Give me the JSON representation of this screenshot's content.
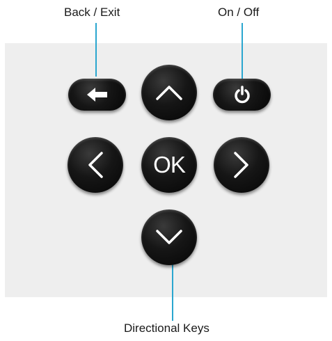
{
  "labels": {
    "back_exit": "Back / Exit",
    "on_off": "On / Off",
    "directional_keys": "Directional Keys"
  },
  "keys": {
    "ok_label": "OK"
  },
  "colors": {
    "leader_line": "#2aa6cf",
    "key_face": "#111111",
    "key_symbol": "#ffffff",
    "panel": "#eeeeee"
  },
  "icons": {
    "back": "arrow-left-icon",
    "power": "power-icon",
    "up": "chevron-up-icon",
    "down": "chevron-down-icon",
    "left": "chevron-left-icon",
    "right": "chevron-right-icon"
  }
}
